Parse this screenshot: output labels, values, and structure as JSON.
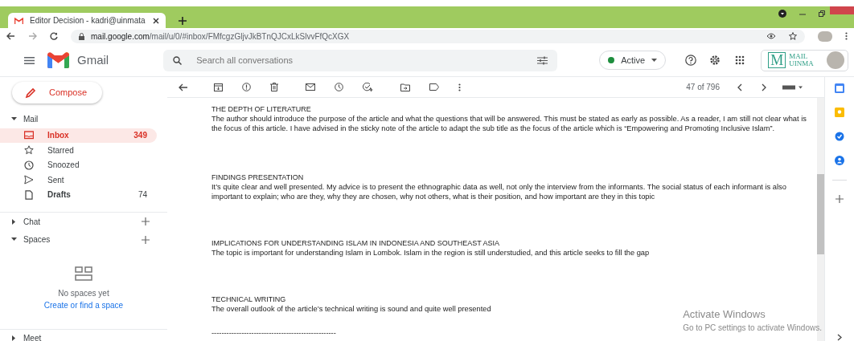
{
  "browser": {
    "tab_title": "Editor Decision - kadri@uinmata",
    "url_host": "mail.google.com",
    "url_path": "/mail/u/0/#inbox/FMfcgzGljvJkBTnQJCxLkSlvvFfQcXGX"
  },
  "header": {
    "app_name": "Gmail",
    "search_placeholder": "Search all conversations",
    "status": "Active",
    "brand_letter": "M",
    "brand_line1": "MAIL",
    "brand_line2": "UINMA"
  },
  "compose": "Compose",
  "mail": {
    "label": "Mail",
    "expanded": true,
    "items": [
      {
        "label": "Inbox",
        "count": "349",
        "selected": true,
        "unread": true,
        "kind": "inbox"
      },
      {
        "label": "Starred",
        "selected": false,
        "unread": false,
        "kind": "star"
      },
      {
        "label": "Snoozed",
        "selected": false,
        "unread": false,
        "kind": "clock"
      },
      {
        "label": "Sent",
        "selected": false,
        "unread": false,
        "kind": "send"
      },
      {
        "label": "Drafts",
        "count": "74",
        "selected": false,
        "unread": true,
        "kind": "draft"
      }
    ]
  },
  "chat": {
    "label": "Chat",
    "expanded": false
  },
  "spaces": {
    "label": "Spaces",
    "expanded": true,
    "empty_text": "No spaces yet",
    "link": "Create or find a space"
  },
  "meet": {
    "label": "Meet",
    "expanded": false
  },
  "toolbar": {
    "counter": "47 of 796"
  },
  "sections": [
    {
      "heading": "THE DEPTH OF LITERATURE",
      "body": "The author should introduce the purpose of the article and what the questions that will be answered. This must be stated as early as possible. As a reader, I am still not clear what is the focus of this article. I have advised in the sticky note of the article to adapt the sub title as the focus of the article which is “Empowering and Promoting Inclusive Islam”."
    },
    {
      "heading": "FINDINGS PRESENTATION",
      "body": "It’s quite clear and well presented. My advice is to present the ethnographic data as well, not only the interview from the informants. The social status of each informant is also important to explain; who are they, why they are chosen, why not others, what is their position, and how important are they in this topic"
    },
    {
      "heading": "IMPLICATIONS FOR UNDERSTANDING ISLAM IN INDONESIA AND SOUTHEAST ASIA",
      "body": "The topic is important for understanding Islam in Lombok. Islam in the region is still understudied, and this article seeks to fill the gap"
    },
    {
      "heading": "TECHNICAL WRITING",
      "body": "The overall outlook of the article’s technical writing is sound and quite well presented"
    }
  ],
  "separator": "--------------------------------------------------",
  "os_notice": {
    "title": "Activate Windows",
    "subtitle": "Go to PC settings to activate Windows."
  }
}
